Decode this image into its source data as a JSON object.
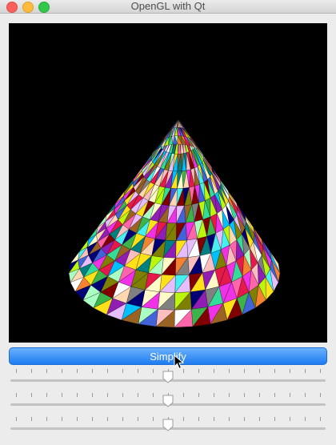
{
  "window": {
    "title": "OpenGL with Qt"
  },
  "button": {
    "label": "Simplify"
  },
  "sliders": [
    {
      "name": "slider-1",
      "value": 0.5,
      "ticks": 21
    },
    {
      "name": "slider-2",
      "value": 0.5,
      "ticks": 21
    },
    {
      "name": "slider-3",
      "value": 0.5,
      "ticks": 21
    }
  ],
  "colors": {
    "viewport_bg": "#000000",
    "button": "#1d7cf2",
    "close": "#fc605c",
    "minimize": "#fdbc40",
    "zoom": "#34c84a"
  }
}
